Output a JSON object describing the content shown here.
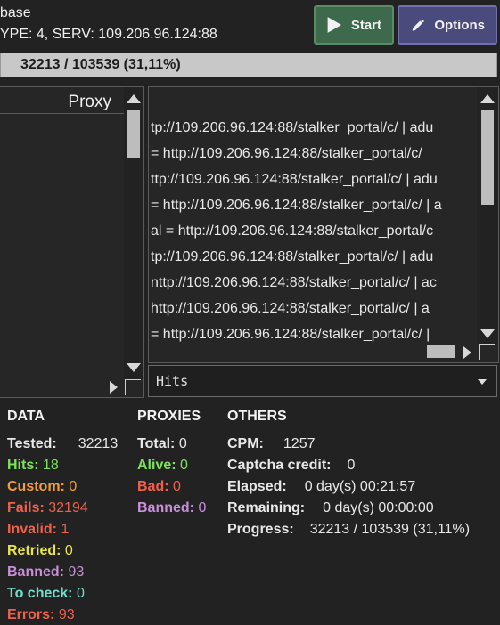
{
  "header": {
    "line1": "base",
    "line2": "YPE: 4, SERV: 109.206.96.124:88"
  },
  "buttons": {
    "start": "Start",
    "options": "Options"
  },
  "progress_bar": {
    "text": "32213 / 103539 (31,11%)",
    "fraction": 0.3111
  },
  "proxy_panel": {
    "header": "Proxy"
  },
  "log_lines": [
    "tp://109.206.96.124:88/stalker_portal/c/ | adu",
    " = http://109.206.96.124:88/stalker_portal/c/",
    "ttp://109.206.96.124:88/stalker_portal/c/ | adu",
    "= http://109.206.96.124:88/stalker_portal/c/ | a",
    "al = http://109.206.96.124:88/stalker_portal/c",
    "tp://109.206.96.124:88/stalker_portal/c/ | adu",
    "nttp://109.206.96.124:88/stalker_portal/c/ | ac",
    " http://109.206.96.124:88/stalker_portal/c/ | a",
    "= http://109.206.96.124:88/stalker_portal/c/ |"
  ],
  "filter_select": {
    "selected": "Hits"
  },
  "colors": {
    "hits": "#7ee35a",
    "custom": "#f39c3a",
    "fails": "#f0604a",
    "invalid": "#f0604a",
    "retried": "#e8e54a",
    "banned": "#c890d8",
    "to_check": "#6de0d0",
    "errors": "#f0604a",
    "alive": "#7ee35a",
    "bad": "#f0604a"
  },
  "stats": {
    "data": {
      "title": "DATA",
      "tested_label": "Tested:",
      "tested": "32213",
      "hits_label": "Hits:",
      "hits": "18",
      "custom_label": "Custom:",
      "custom": "0",
      "fails_label": "Fails:",
      "fails": "32194",
      "invalid_label": "Invalid:",
      "invalid": "1",
      "retried_label": "Retried:",
      "retried": "0",
      "banned_label": "Banned:",
      "banned": "93",
      "to_check_label": "To check:",
      "to_check": "0",
      "errors_label": "Errors:",
      "errors": "93"
    },
    "proxies": {
      "title": "PROXIES",
      "total_label": "Total:",
      "total": "0",
      "alive_label": "Alive:",
      "alive": "0",
      "bad_label": "Bad:",
      "bad": "0",
      "banned_label": "Banned:",
      "banned": "0"
    },
    "others": {
      "title": "OTHERS",
      "cpm_label": "CPM:",
      "cpm": "1257",
      "captcha_label": "Captcha credit:",
      "captcha": "0",
      "elapsed_label": "Elapsed:",
      "elapsed": "0 day(s) 00:21:57",
      "remaining_label": "Remaining:",
      "remaining": "0 day(s) 00:00:00",
      "progress_label": "Progress:",
      "progress": "32213 / 103539 (31,11%)"
    }
  }
}
